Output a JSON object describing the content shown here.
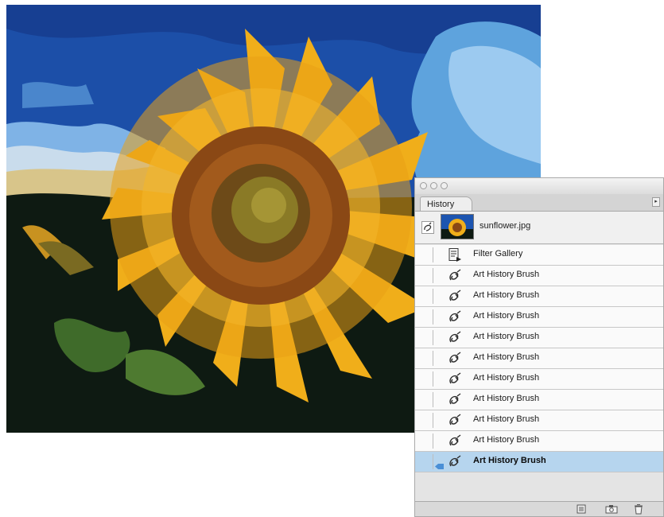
{
  "panel": {
    "tab_label": "History",
    "snapshot": {
      "name": "sunflower.jpg"
    },
    "states": [
      {
        "label": "Filter Gallery",
        "icon": "filter-document-icon",
        "current": false
      },
      {
        "label": "Art History Brush",
        "icon": "art-history-brush-icon",
        "current": false
      },
      {
        "label": "Art History Brush",
        "icon": "art-history-brush-icon",
        "current": false
      },
      {
        "label": "Art History Brush",
        "icon": "art-history-brush-icon",
        "current": false
      },
      {
        "label": "Art History Brush",
        "icon": "art-history-brush-icon",
        "current": false
      },
      {
        "label": "Art History Brush",
        "icon": "art-history-brush-icon",
        "current": false
      },
      {
        "label": "Art History Brush",
        "icon": "art-history-brush-icon",
        "current": false
      },
      {
        "label": "Art History Brush",
        "icon": "art-history-brush-icon",
        "current": false
      },
      {
        "label": "Art History Brush",
        "icon": "art-history-brush-icon",
        "current": false
      },
      {
        "label": "Art History Brush",
        "icon": "art-history-brush-icon",
        "current": false
      },
      {
        "label": "Art History Brush",
        "icon": "art-history-brush-icon",
        "current": true
      }
    ],
    "footer_buttons": [
      "new-document-icon",
      "camera-icon",
      "trash-icon"
    ]
  },
  "colors": {
    "sky": "#1d55b0",
    "petals": "#f2b21e",
    "center": "#8a4a16",
    "foliage": "#0e1b12",
    "selection": "#b6d5ee"
  }
}
